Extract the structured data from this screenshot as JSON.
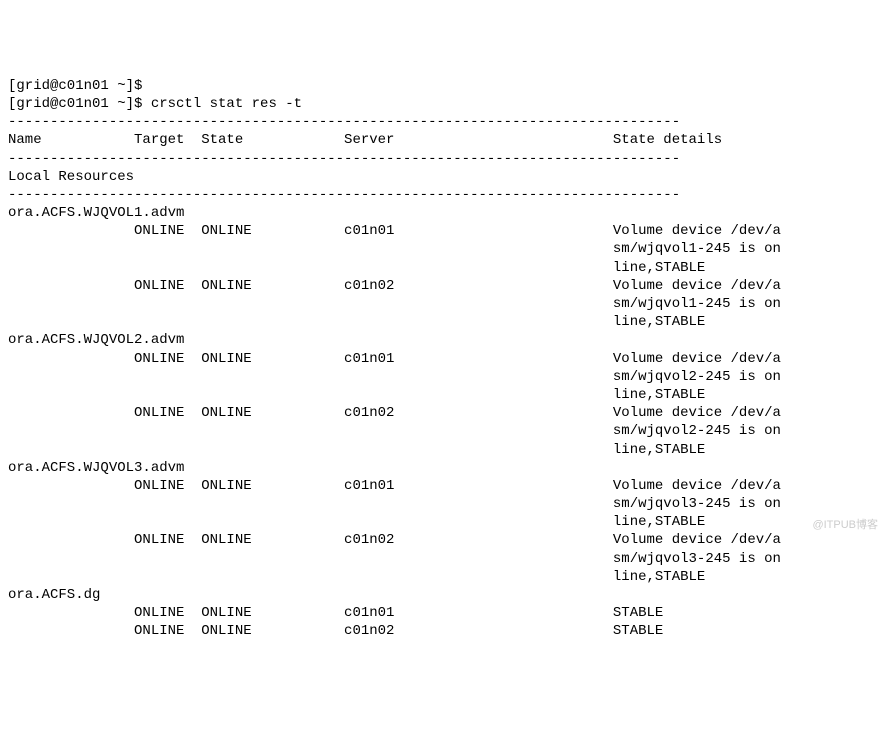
{
  "prompt_prev": "[grid@c01n01 ~]$",
  "prompt": "[grid@c01n01 ~]$ ",
  "command": "crsctl stat res -t",
  "dash80": "--------------------------------------------------------------------------------",
  "header": {
    "name": "Name",
    "target": "Target",
    "state": "State",
    "server": "Server",
    "details": "State details"
  },
  "section_local": "Local Resources",
  "resources": [
    {
      "name": "ora.ACFS.WJQVOL1.advm",
      "rows": [
        {
          "target": "ONLINE",
          "state": "ONLINE",
          "server": "c01n01",
          "details": [
            "Volume device /dev/a",
            "sm/wjqvol1-245 is on",
            "line,STABLE"
          ]
        },
        {
          "target": "ONLINE",
          "state": "ONLINE",
          "server": "c01n02",
          "details": [
            "Volume device /dev/a",
            "sm/wjqvol1-245 is on",
            "line,STABLE"
          ]
        }
      ]
    },
    {
      "name": "ora.ACFS.WJQVOL2.advm",
      "rows": [
        {
          "target": "ONLINE",
          "state": "ONLINE",
          "server": "c01n01",
          "details": [
            "Volume device /dev/a",
            "sm/wjqvol2-245 is on",
            "line,STABLE"
          ]
        },
        {
          "target": "ONLINE",
          "state": "ONLINE",
          "server": "c01n02",
          "details": [
            "Volume device /dev/a",
            "sm/wjqvol2-245 is on",
            "line,STABLE"
          ]
        }
      ]
    },
    {
      "name": "ora.ACFS.WJQVOL3.advm",
      "rows": [
        {
          "target": "ONLINE",
          "state": "ONLINE",
          "server": "c01n01",
          "details": [
            "Volume device /dev/a",
            "sm/wjqvol3-245 is on",
            "line,STABLE"
          ]
        },
        {
          "target": "ONLINE",
          "state": "ONLINE",
          "server": "c01n02",
          "details": [
            "Volume device /dev/a",
            "sm/wjqvol3-245 is on",
            "line,STABLE"
          ]
        }
      ]
    },
    {
      "name": "ora.ACFS.dg",
      "rows": [
        {
          "target": "ONLINE",
          "state": "ONLINE",
          "server": "c01n01",
          "details": [
            "STABLE"
          ]
        },
        {
          "target": "ONLINE",
          "state": "ONLINE",
          "server": "c01n02",
          "details": [
            "STABLE"
          ]
        }
      ]
    }
  ],
  "cols": {
    "target": 15,
    "state": 23,
    "server": 40,
    "details": 72
  },
  "watermark": "@ITPUB博客"
}
